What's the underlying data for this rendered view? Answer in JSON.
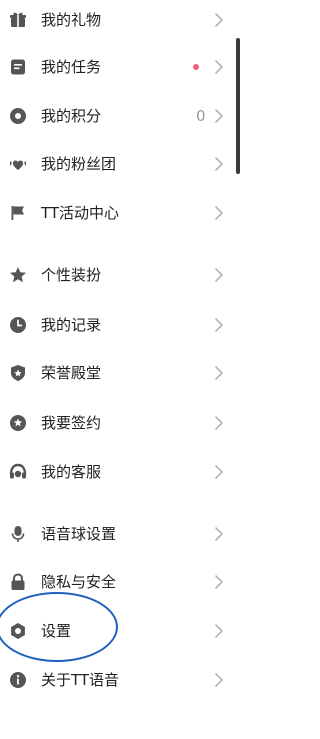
{
  "menu": {
    "items": [
      {
        "icon": "gift-icon",
        "label": "我的礼物"
      },
      {
        "icon": "task-icon",
        "label": "我的任务",
        "has_dot": true,
        "dot_color": "#f0607a"
      },
      {
        "icon": "points-icon",
        "label": "我的积分",
        "value": "0"
      },
      {
        "icon": "fan-club-icon",
        "label": "我的粉丝团"
      },
      {
        "icon": "flag-icon",
        "label": "TT活动中心"
      },
      {
        "icon": "star-icon",
        "label": "个性装扮"
      },
      {
        "icon": "clock-icon",
        "label": "我的记录"
      },
      {
        "icon": "shield-icon",
        "label": "荣誉殿堂"
      },
      {
        "icon": "badge-icon",
        "label": "我要签约"
      },
      {
        "icon": "headset-icon",
        "label": "我的客服"
      },
      {
        "icon": "microphone-icon",
        "label": "语音球设置"
      },
      {
        "icon": "lock-icon",
        "label": "隐私与安全"
      },
      {
        "icon": "settings-icon",
        "label": "设置"
      },
      {
        "icon": "info-icon",
        "label": "关于TT语音"
      }
    ]
  },
  "colors": {
    "icon": "#555555",
    "text": "#222222",
    "chevron": "#b5b5b5",
    "dot": "#f0607a",
    "annotation_circle": "#1f5fbf"
  }
}
